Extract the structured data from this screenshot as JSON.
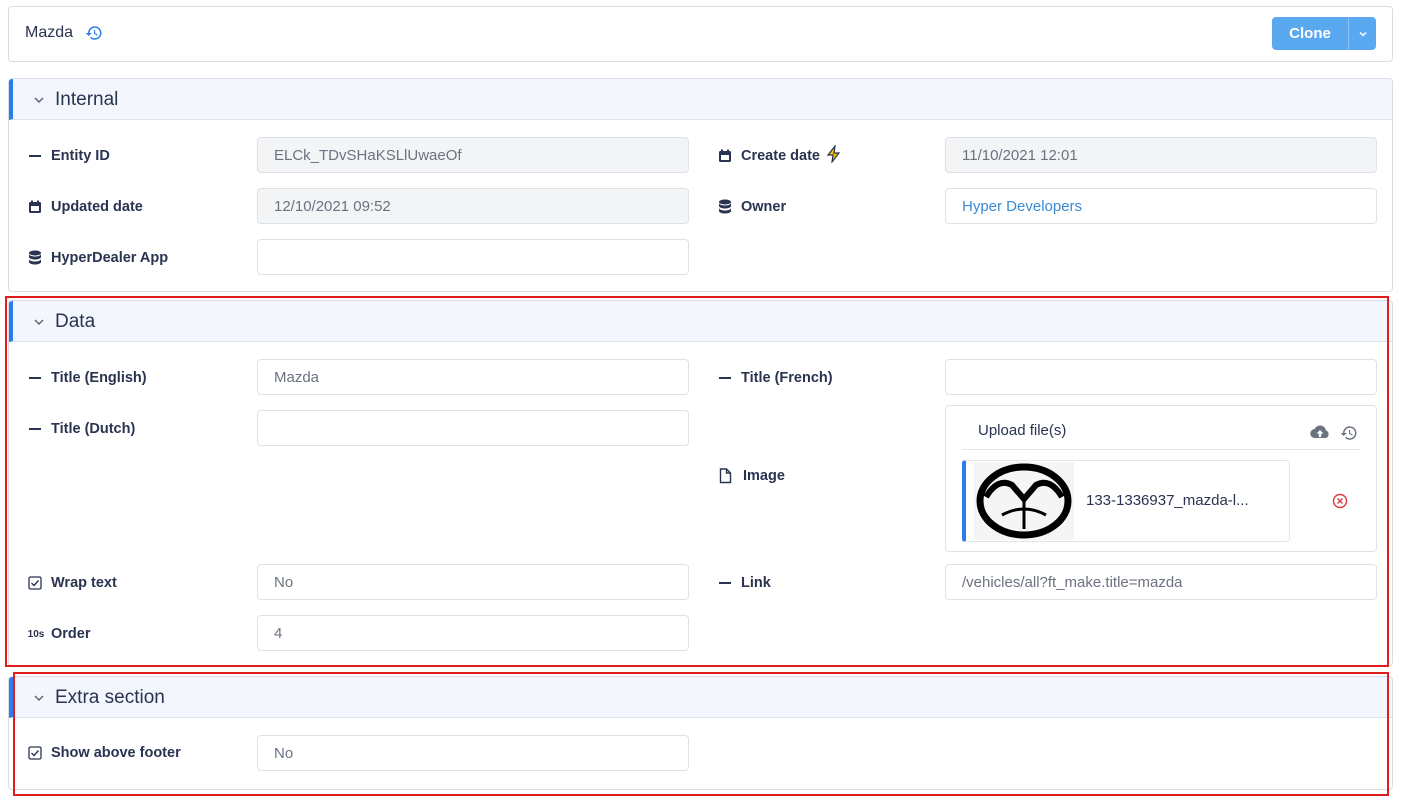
{
  "header": {
    "title": "Mazda",
    "clone_label": "Clone"
  },
  "sections": {
    "internal": {
      "title": "Internal",
      "entity_id": {
        "label": "Entity ID",
        "value": "ELCk_TDvSHaKSLlUwaeOf"
      },
      "create_date": {
        "label": "Create date",
        "value": "11/10/2021 12:01"
      },
      "updated_date": {
        "label": "Updated date",
        "value": "12/10/2021 09:52"
      },
      "owner": {
        "label": "Owner",
        "value": "Hyper Developers"
      },
      "app": {
        "label": "HyperDealer App",
        "value": ""
      }
    },
    "data": {
      "title": "Data",
      "title_en": {
        "label": "Title (English)",
        "value": "Mazda"
      },
      "title_fr": {
        "label": "Title (French)",
        "value": ""
      },
      "title_nl": {
        "label": "Title (Dutch)",
        "value": ""
      },
      "image": {
        "label": "Image",
        "upload_label": "Upload file(s)",
        "file_name": "133-1336937_mazda-l..."
      },
      "wrap_text": {
        "label": "Wrap text",
        "value": "No"
      },
      "link": {
        "label": "Link",
        "value": "/vehicles/all?ft_make.title=mazda"
      },
      "order": {
        "label": "Order",
        "value": "4",
        "icon_text": "10s"
      }
    },
    "extra": {
      "title": "Extra section",
      "show_above_footer": {
        "label": "Show above footer",
        "value": "No"
      }
    }
  },
  "colors": {
    "accent": "#2b7de9",
    "button": "#5aa8f0",
    "highlight": "#e21b1b",
    "bolt": "#f2c200"
  }
}
